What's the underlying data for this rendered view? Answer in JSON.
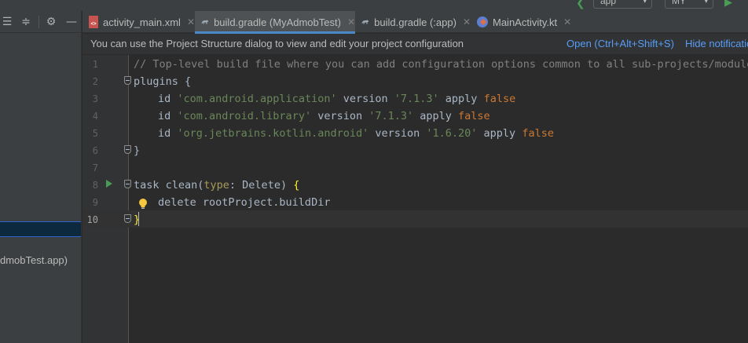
{
  "toolbar": {
    "run_config": "app",
    "device": "MY"
  },
  "tabs": [
    {
      "label": "activity_main.xml",
      "icon": "xml-file-icon",
      "active": false
    },
    {
      "label": "build.gradle (MyAdmobTest)",
      "icon": "gradle-icon",
      "active": true
    },
    {
      "label": "build.gradle (:app)",
      "icon": "gradle-icon",
      "active": false
    },
    {
      "label": "MainActivity.kt",
      "icon": "kotlin-file-icon",
      "active": false
    }
  ],
  "notification": {
    "text": "You can use the Project Structure dialog to view and edit your project configuration",
    "open_link": "Open (Ctrl+Alt+Shift+S)",
    "hide_link": "Hide notification"
  },
  "project_tree": {
    "item_text": "dmobTest.app)"
  },
  "editor": {
    "current_line": 10,
    "line_numbers": [
      "1",
      "2",
      "3",
      "4",
      "5",
      "6",
      "7",
      "8",
      "9",
      "10"
    ],
    "lines": {
      "l1_comment": "// Top-level build file where you can add configuration options common to all sub-projects/modules.",
      "l2_plugins": "plugins {",
      "l3_id": "id ",
      "l3_str": "'com.android.application'",
      "l3_version": " version ",
      "l3_ver": "'7.1.3'",
      "l3_apply": " apply ",
      "l3_false": "false",
      "l4_id": "id ",
      "l4_str": "'com.android.library'",
      "l4_version": " version ",
      "l4_ver": "'7.1.3'",
      "l4_apply": " apply ",
      "l4_false": "false",
      "l5_id": "id ",
      "l5_str": "'org.jetbrains.kotlin.android'",
      "l5_version": " version ",
      "l5_ver": "'1.6.20'",
      "l5_apply": " apply ",
      "l5_false": "false",
      "l6_close": "}",
      "l8_task": "task clean(",
      "l8_type": "type",
      "l8_rest": ": Delete) ",
      "l8_brace": "{",
      "l9_delete": "delete rootProject.buildDir",
      "l10_close": "}"
    }
  },
  "colors": {
    "accent": "#4a88c7",
    "link": "#589df6",
    "string": "#6a8759",
    "keyword": "#cc7832",
    "run_green": "#499c54"
  }
}
